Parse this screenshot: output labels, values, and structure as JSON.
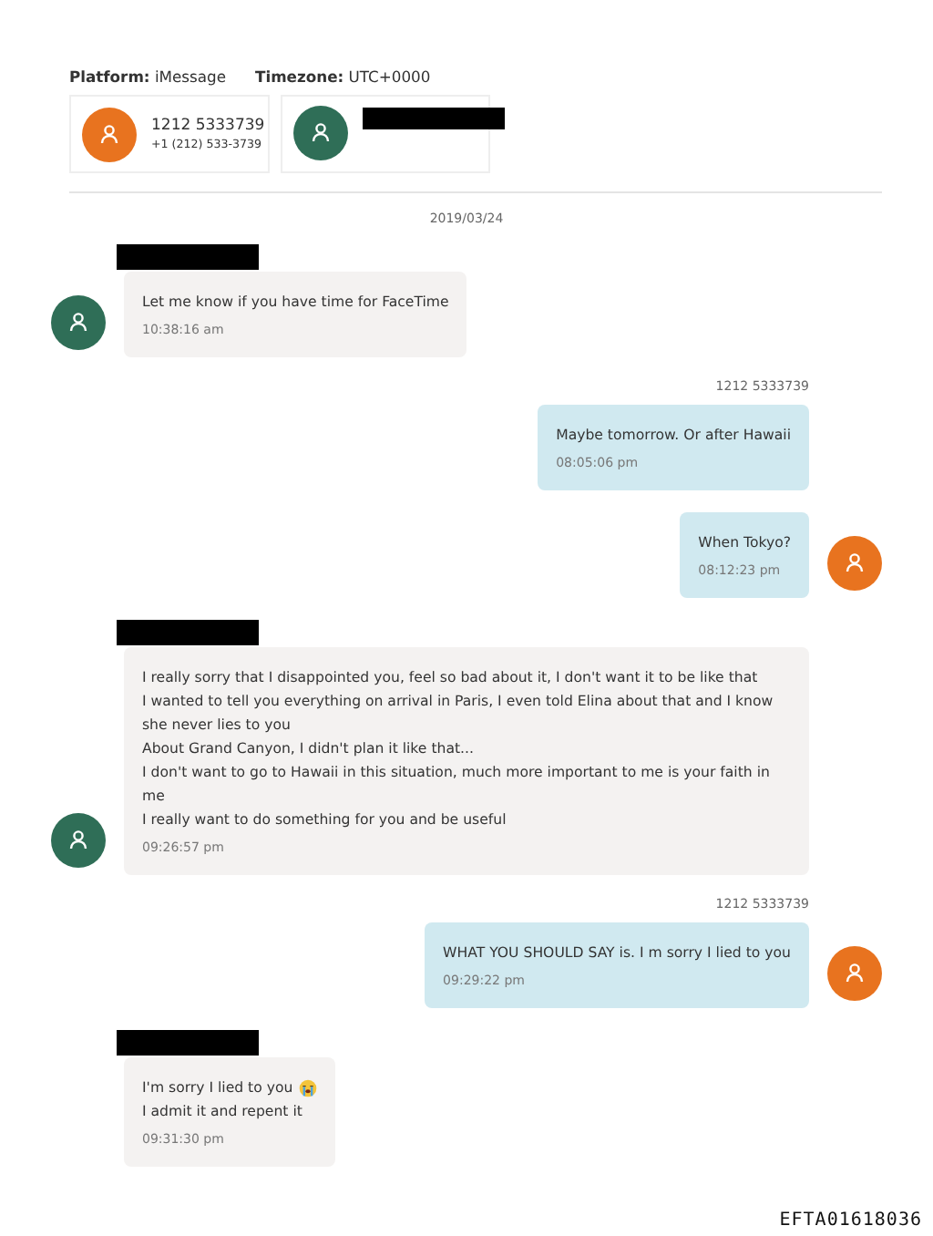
{
  "header": {
    "platform": "**Platform:** iMessage",
    "timezone": "**Timezone:** UTC+0000"
  },
  "participants": [
    {
      "name": "1212 5333739",
      "number": "+1 (212) 533-3739",
      "color": "#e8731f",
      "name_redacted": false
    },
    {
      "color": "#2f6e57",
      "name_redacted": true
    }
  ],
  "date": "2019/03/24",
  "messages": [
    {
      "kind": "incoming",
      "sender_redacted": true,
      "color": "#2f6e57",
      "lines": [
        {
          "kind": "plain",
          "text": "Let me know if you have time for FaceTime"
        }
      ],
      "time": "10:38:16 am"
    },
    {
      "kind": "outgoing",
      "sender": "1212 5333739",
      "lines": [
        {
          "kind": "plain",
          "text": "Maybe tomorrow. Or after Hawaii"
        }
      ],
      "time": "08:05:06 pm"
    },
    {
      "kind": "outgoing",
      "color": "#e8731f",
      "lines": [
        {
          "kind": "plain",
          "text": "When Tokyo?"
        }
      ],
      "time": "08:12:23 pm"
    },
    {
      "kind": "incoming",
      "sender_redacted": true,
      "color": "#2f6e57",
      "lines": [
        {
          "kind": "plain",
          "text": "I really sorry that I disappointed you, feel so bad about it, I don't want it to be like that"
        },
        {
          "kind": "plain",
          "text": "I wanted to tell you everything on arrival in Paris, I even told Elina about that and I know she never lies to you"
        },
        {
          "kind": "plain",
          "text": "About Grand Canyon, I didn't plan it like that..."
        },
        {
          "kind": "plain",
          "text": "I don't want to go to Hawaii in this situation, much more important to me is your faith in me"
        },
        {
          "kind": "plain",
          "text": "I really want to do something for you and be useful"
        }
      ],
      "time": "09:26:57 pm"
    },
    {
      "kind": "outgoing",
      "sender": "1212 5333739",
      "color": "#e8731f",
      "lines": [
        {
          "kind": "plain",
          "text": "WHAT YOU SHOULD SAY is.  I m sorry I lied to you"
        }
      ],
      "time": "09:29:22 pm"
    },
    {
      "kind": "incoming",
      "sender_redacted": true,
      "lines": [
        {
          "kind": "crying-emoji",
          "text": "I'm sorry I lied to you"
        },
        {
          "kind": "plain",
          "text": "I admit it and repent it"
        }
      ],
      "time": "09:31:30 pm"
    }
  ],
  "stamp": "EFTA01618036"
}
